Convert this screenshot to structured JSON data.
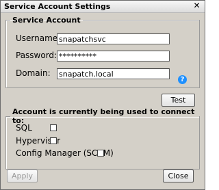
{
  "window": {
    "title": "Service Account Settings"
  },
  "service_account": {
    "legend": "Service Account",
    "username_label": "Username:",
    "username_value": "snapatchsvc",
    "password_label": "Password:",
    "password_value": "**********",
    "domain_label": "Domain:",
    "domain_value": "snapatch.local",
    "help_icon": "?"
  },
  "test_button": "Test",
  "usage": {
    "legend": "Account is currently being used to connect to:",
    "items": [
      {
        "label": "SQL",
        "checked": false
      },
      {
        "label": "Hypervisor",
        "checked": false
      },
      {
        "label": "Config Manager (SCCM)",
        "checked": false
      }
    ]
  },
  "buttons": {
    "apply": "Apply",
    "close": "Close"
  },
  "icons": {
    "close": "close-icon",
    "help": "help-icon"
  }
}
